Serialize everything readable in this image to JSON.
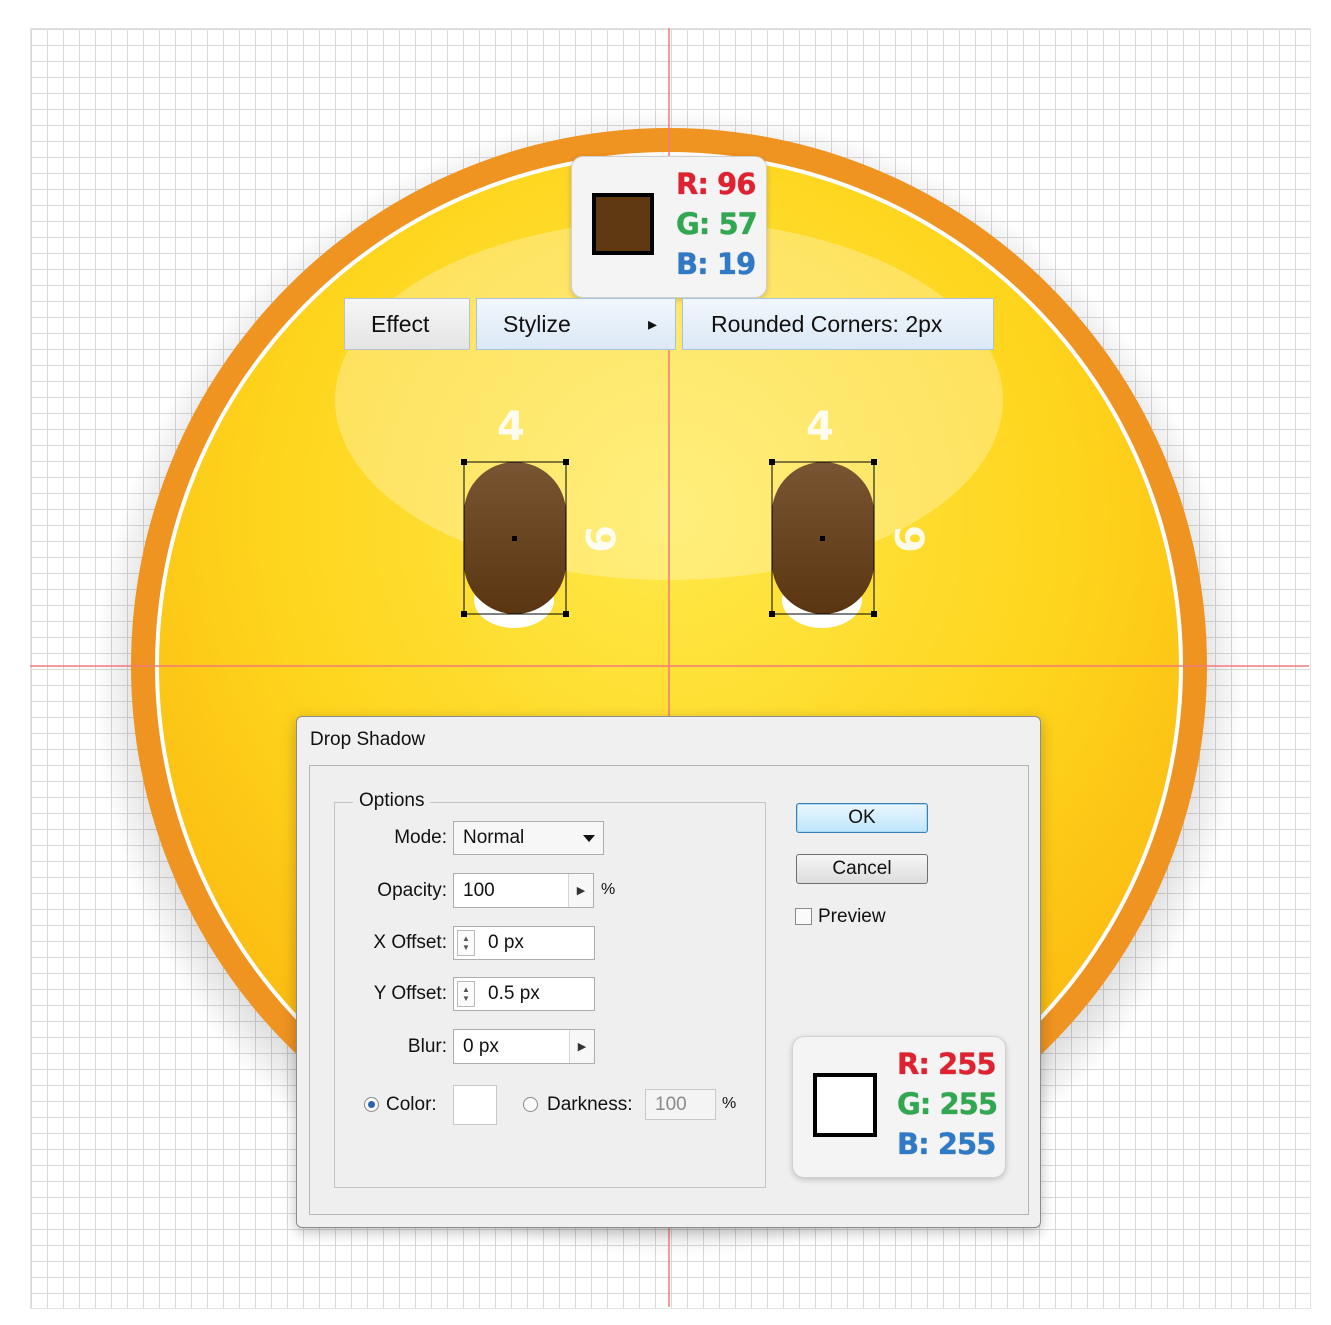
{
  "top_color": {
    "swatch": "#603913",
    "r": "R: 96",
    "g": "G: 57",
    "b": "B: 19"
  },
  "menu": {
    "effect": "Effect",
    "stylize": "Stylize",
    "stylize_arrow": "▸",
    "rounded": "Rounded Corners: 2px"
  },
  "eye_dims": {
    "left_width": "4",
    "left_height": "9",
    "right_width": "4",
    "right_height": "9"
  },
  "dialog": {
    "title": "Drop Shadow",
    "options_title": "Options",
    "mode": {
      "label": "Mode:",
      "value": "Normal"
    },
    "opacity": {
      "label": "Opacity:",
      "value": "100",
      "unit": "%"
    },
    "x_offset": {
      "label": "X Offset:",
      "value": "0 px"
    },
    "y_offset": {
      "label": "Y Offset:",
      "value": "0.5 px"
    },
    "blur": {
      "label": "Blur:",
      "value": "0 px"
    },
    "color": {
      "label": "Color:",
      "swatch": "#ffffff",
      "selected": true
    },
    "darkness": {
      "label": "Darkness:",
      "value": "100",
      "unit": "%",
      "selected": false
    },
    "ok": "OK",
    "cancel": "Cancel",
    "preview": {
      "label": "Preview",
      "checked": false
    }
  },
  "bottom_color": {
    "swatch": "#ffffff",
    "r": "R: 255",
    "g": "G: 255",
    "b": "B: 255"
  },
  "colors": {
    "guide": "#f27a7a",
    "ring": "#ef9321",
    "face": "#fed51d",
    "eye": "#603913"
  }
}
